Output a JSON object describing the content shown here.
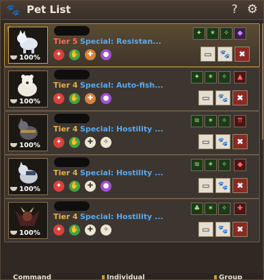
{
  "window": {
    "title": "Pet List",
    "help": "?",
    "settings_icon": "gear-icon"
  },
  "pets": [
    {
      "tier": "Tier 5",
      "special": "Special: Resistan...",
      "hunger": "100%",
      "selected": true,
      "skills": [
        "red",
        "green",
        "orange",
        "purple"
      ],
      "passives": [
        "green",
        "green",
        "green",
        "purple"
      ],
      "accent": "#ff6a55"
    },
    {
      "tier": "Tier 4",
      "special": "Special: Auto-fish...",
      "hunger": "100%",
      "selected": false,
      "skills": [
        "red",
        "green",
        "orange",
        "purple"
      ],
      "passives": [
        "green",
        "green",
        "green",
        "red"
      ],
      "accent": "#e8b04a"
    },
    {
      "tier": "Tier 4",
      "special": "Special: Hostility ...",
      "hunger": "100%",
      "selected": false,
      "skills": [
        "red",
        "green",
        "white",
        "white"
      ],
      "passives": [
        "green",
        "green",
        "green",
        "red"
      ],
      "accent": "#e8b04a"
    },
    {
      "tier": "Tier 4",
      "special": "Special: Hostility ...",
      "hunger": "100%",
      "selected": false,
      "skills": [
        "red",
        "green",
        "white",
        "purple"
      ],
      "passives": [
        "green",
        "green",
        "green",
        "red"
      ],
      "accent": "#e8b04a"
    },
    {
      "tier": "Tier 4",
      "special": "Special: Hostility ...",
      "hunger": "100%",
      "selected": false,
      "skills": [
        "red",
        "green",
        "white",
        "white"
      ],
      "passives": [
        "green",
        "green",
        "green",
        "red"
      ],
      "accent": "#e8b04a"
    }
  ],
  "bottom_tabs": [
    "Command",
    "Individual",
    "Group"
  ]
}
